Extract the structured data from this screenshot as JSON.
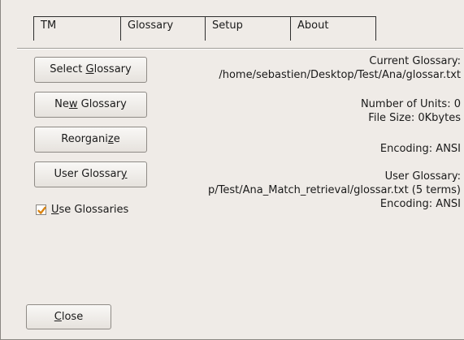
{
  "tabs": [
    {
      "label_pre": "TM",
      "label_ul": "",
      "label_post": ""
    },
    {
      "label_pre": "Glossary",
      "label_ul": "",
      "label_post": ""
    },
    {
      "label_pre": "Setup",
      "label_ul": "",
      "label_post": ""
    },
    {
      "label_pre": "About",
      "label_ul": "",
      "label_post": ""
    }
  ],
  "active_tab": "Glossary",
  "buttons": {
    "select_glossary": {
      "pre": "Select ",
      "ul": "G",
      "post": "lossary"
    },
    "new_glossary": {
      "pre": "Ne",
      "ul": "w",
      "post": " Glossary"
    },
    "reorganize": {
      "pre": "Reorgani",
      "ul": "z",
      "post": "e"
    },
    "user_glossary": {
      "pre": "User Glossar",
      "ul": "y",
      "post": ""
    },
    "close": {
      "pre": "",
      "ul": "C",
      "post": "lose"
    }
  },
  "use_glossaries": {
    "checked": true,
    "label_ul": "U",
    "label_post": "se Glossaries"
  },
  "info": {
    "current_glossary_label": "Current Glossary:",
    "current_glossary_path": "/home/sebastien/Desktop/Test/Ana/glossar.txt",
    "number_of_units": "Number of Units: 0",
    "file_size": "File Size: 0Kbytes",
    "encoding": "Encoding: ANSI",
    "user_glossary_label": "User Glossary:",
    "user_glossary_path": "p/Test/Ana_Match_retrieval/glossar.txt (5 terms)",
    "user_glossary_encoding": "Encoding: ANSI"
  },
  "colors": {
    "window_bg": "#efebe7",
    "checkmark": "#d9820f"
  }
}
